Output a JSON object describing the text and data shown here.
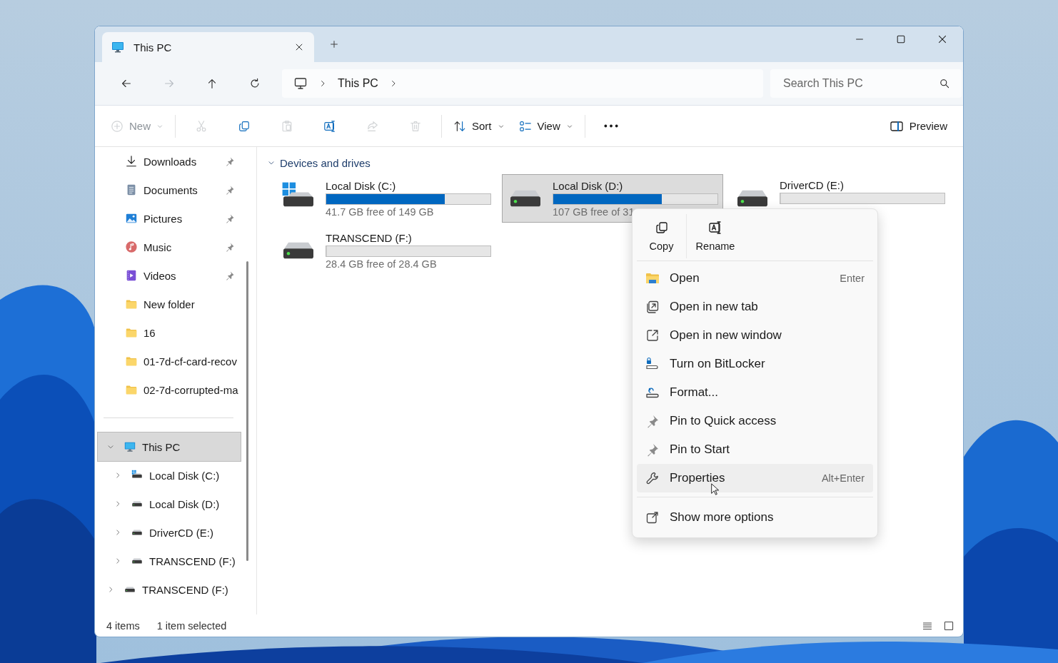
{
  "tab": {
    "title": "This PC",
    "selected": true
  },
  "address": {
    "path": [
      "This PC"
    ]
  },
  "search": {
    "placeholder": "Search This PC"
  },
  "toolbar": {
    "groups": [
      [
        {
          "kind": "new",
          "label": "New",
          "disabled": true
        }
      ],
      [
        {
          "kind": "cut",
          "disabled": true
        },
        {
          "kind": "copy",
          "disabled": false
        },
        {
          "kind": "paste",
          "disabled": true
        },
        {
          "kind": "rename",
          "disabled": false
        },
        {
          "kind": "share",
          "disabled": true
        },
        {
          "kind": "delete",
          "disabled": true
        }
      ],
      [
        {
          "kind": "sort",
          "label": "Sort",
          "disabled": false
        },
        {
          "kind": "view",
          "label": "View",
          "disabled": false
        }
      ],
      [
        {
          "kind": "more",
          "disabled": false
        }
      ]
    ],
    "preview": {
      "label": "Preview"
    }
  },
  "sidebar": {
    "quick_access": [
      {
        "kind": "download",
        "label": "Downloads",
        "pinned": true
      },
      {
        "kind": "document",
        "label": "Documents",
        "pinned": true
      },
      {
        "kind": "picture",
        "label": "Pictures",
        "pinned": true
      },
      {
        "kind": "music",
        "label": "Music",
        "pinned": true
      },
      {
        "kind": "video",
        "label": "Videos",
        "pinned": true
      },
      {
        "kind": "folder",
        "label": "New folder",
        "pinned": false
      },
      {
        "kind": "folder",
        "label": "16",
        "pinned": false
      },
      {
        "kind": "folder",
        "label": "01-7d-cf-card-recov",
        "pinned": false
      },
      {
        "kind": "folder",
        "label": "02-7d-corrupted-ma",
        "pinned": false
      }
    ],
    "tree": [
      {
        "kind": "pc",
        "label": "This PC",
        "expanded": true,
        "selected": true,
        "children": [
          {
            "kind": "windows-drive",
            "label": "Local Disk (C:)",
            "expanded": false,
            "selected": false
          },
          {
            "kind": "drive",
            "label": "Local Disk (D:)",
            "expanded": false,
            "selected": false
          },
          {
            "kind": "drive",
            "label": "DriverCD (E:)",
            "expanded": false,
            "selected": false
          },
          {
            "kind": "drive",
            "label": "TRANSCEND (F:)",
            "expanded": false,
            "selected": false
          }
        ]
      },
      {
        "kind": "drive",
        "label": "TRANSCEND (F:)",
        "expanded": false,
        "selected": false
      }
    ]
  },
  "content": {
    "section": {
      "title": "Devices and drives",
      "expanded": true
    },
    "drives": [
      {
        "kind": "windows-drive",
        "name": "Local Disk (C:)",
        "level": 0.72,
        "free": "41.7 GB free of 149 GB",
        "selected": false
      },
      {
        "kind": "drive",
        "name": "Local Disk (D:)",
        "level": 0.66,
        "free": "107 GB free of 31",
        "selected": true
      },
      {
        "kind": "drive",
        "name": "DriverCD (E:)",
        "level": 0,
        "selected": false
      },
      {
        "kind": "drive",
        "name": "TRANSCEND (F:)",
        "level": 0,
        "free": "28.4 GB free of 28.4 GB",
        "selected": false
      }
    ]
  },
  "context_menu": {
    "actions": [
      {
        "kind": "copy",
        "label": "Copy"
      },
      {
        "kind": "rename",
        "label": "Rename"
      }
    ],
    "items": [
      {
        "kind": "open",
        "label": "Open",
        "shortcut": "Enter",
        "hovered": false
      },
      {
        "kind": "new-tab",
        "label": "Open in new tab",
        "hovered": false
      },
      {
        "kind": "new-window",
        "label": "Open in new window",
        "hovered": false
      },
      {
        "kind": "bitlocker",
        "label": "Turn on BitLocker",
        "hovered": false
      },
      {
        "kind": "format",
        "label": "Format...",
        "hovered": false
      },
      {
        "kind": "pin",
        "label": "Pin to Quick access",
        "hovered": false
      },
      {
        "kind": "pin",
        "label": "Pin to Start",
        "hovered": false
      },
      {
        "kind": "properties",
        "label": "Properties",
        "shortcut": "Alt+Enter",
        "hovered": true
      }
    ],
    "extra": [
      {
        "kind": "more-options",
        "label": "Show more options",
        "hovered": false
      }
    ]
  },
  "status_bar": {
    "count": "4 items",
    "selection": "1 item selected",
    "views": [
      {
        "kind": "details"
      },
      {
        "kind": "tiles"
      }
    ]
  }
}
